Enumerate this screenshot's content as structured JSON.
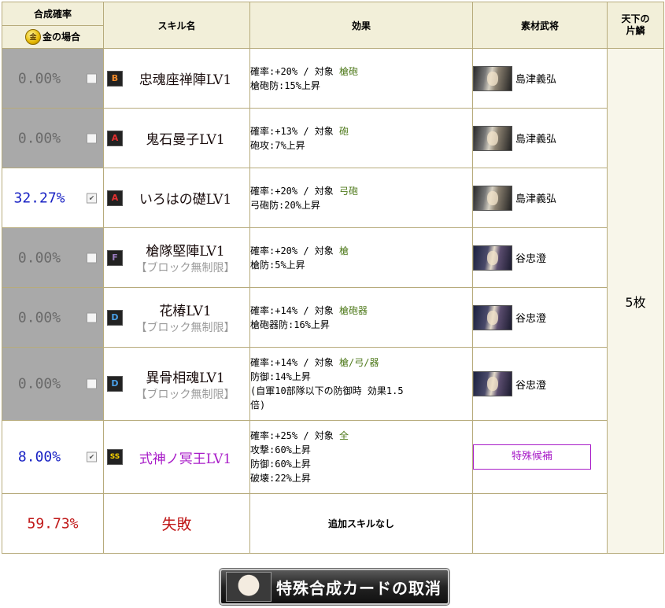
{
  "header": {
    "rate_title": "合成確率",
    "gold_icon_char": "金",
    "gold_case": "金の場合",
    "skill_name": "スキル名",
    "effect": "効果",
    "material": "素材武将",
    "tenka_line1": "天下の",
    "tenka_line2": "片鱗"
  },
  "rows": [
    {
      "rate": "0.00%",
      "checked": false,
      "grade": "B",
      "name": "忠魂座禅陣LV1",
      "note": "",
      "effect_line1_prefix": "確率:+20%  /  対象",
      "target": "槍砲",
      "effect_line2": "槍砲防:15%上昇",
      "effect_line3": "",
      "effect_line4": "",
      "material_name": "島津義弘"
    },
    {
      "rate": "0.00%",
      "checked": false,
      "grade": "A",
      "name": "鬼石曼子LV1",
      "note": "",
      "effect_line1_prefix": "確率:+13%  /  対象",
      "target": "砲",
      "effect_line2": "砲攻:7%上昇",
      "effect_line3": "",
      "effect_line4": "",
      "material_name": "島津義弘"
    },
    {
      "rate": "32.27%",
      "checked": true,
      "grade": "A",
      "name": "いろはの礎LV1",
      "note": "",
      "effect_line1_prefix": "確率:+20%  /  対象",
      "target": "弓砲",
      "effect_line2": "弓砲防:20%上昇",
      "effect_line3": "",
      "effect_line4": "",
      "material_name": "島津義弘"
    },
    {
      "rate": "0.00%",
      "checked": false,
      "grade": "F",
      "name": "槍隊堅陣LV1",
      "note": "【ブロック無制限】",
      "effect_line1_prefix": "確率:+20%  /  対象",
      "target": "槍",
      "effect_line2": "槍防:5%上昇",
      "effect_line3": "",
      "effect_line4": "",
      "material_name": "谷忠澄"
    },
    {
      "rate": "0.00%",
      "checked": false,
      "grade": "D",
      "name": "花椿LV1",
      "note": "【ブロック無制限】",
      "effect_line1_prefix": "確率:+14%  /  対象",
      "target": "槍砲器",
      "effect_line2": "槍砲器防:16%上昇",
      "effect_line3": "",
      "effect_line4": "",
      "material_name": "谷忠澄"
    },
    {
      "rate": "0.00%",
      "checked": false,
      "grade": "D",
      "name": "異骨相魂LV1",
      "note": "【ブロック無制限】",
      "effect_line1_prefix": "確率:+14%  /  対象",
      "target": "槍/弓/器",
      "effect_line2": "防御:14%上昇",
      "effect_line3": "(自軍10部隊以下の防御時 効果1.5",
      "effect_line4": "倍)",
      "material_name": "谷忠澄"
    },
    {
      "rate": "8.00%",
      "checked": true,
      "grade": "SS",
      "name": "式神ノ冥王LV1",
      "note": "",
      "effect_line1_prefix": "確率:+25%  /  対象",
      "target": "全",
      "effect_line2": "攻撃:60%上昇",
      "effect_line3": "防御:60%上昇",
      "effect_line4": "破壊:22%上昇",
      "material_button": "特殊候補"
    }
  ],
  "fail_row": {
    "rate": "59.73%",
    "label": "失敗",
    "effect": "追加スキルなし"
  },
  "tenka_value": "5枚",
  "cancel_button": "特殊合成カードの取消",
  "colors": {
    "rate_on": "#1a23c4",
    "rate_fail": "#c01818",
    "target": "#4f7a1c",
    "ss_skill": "#a81cc8",
    "disabled_bg": "#a9a9a9"
  }
}
